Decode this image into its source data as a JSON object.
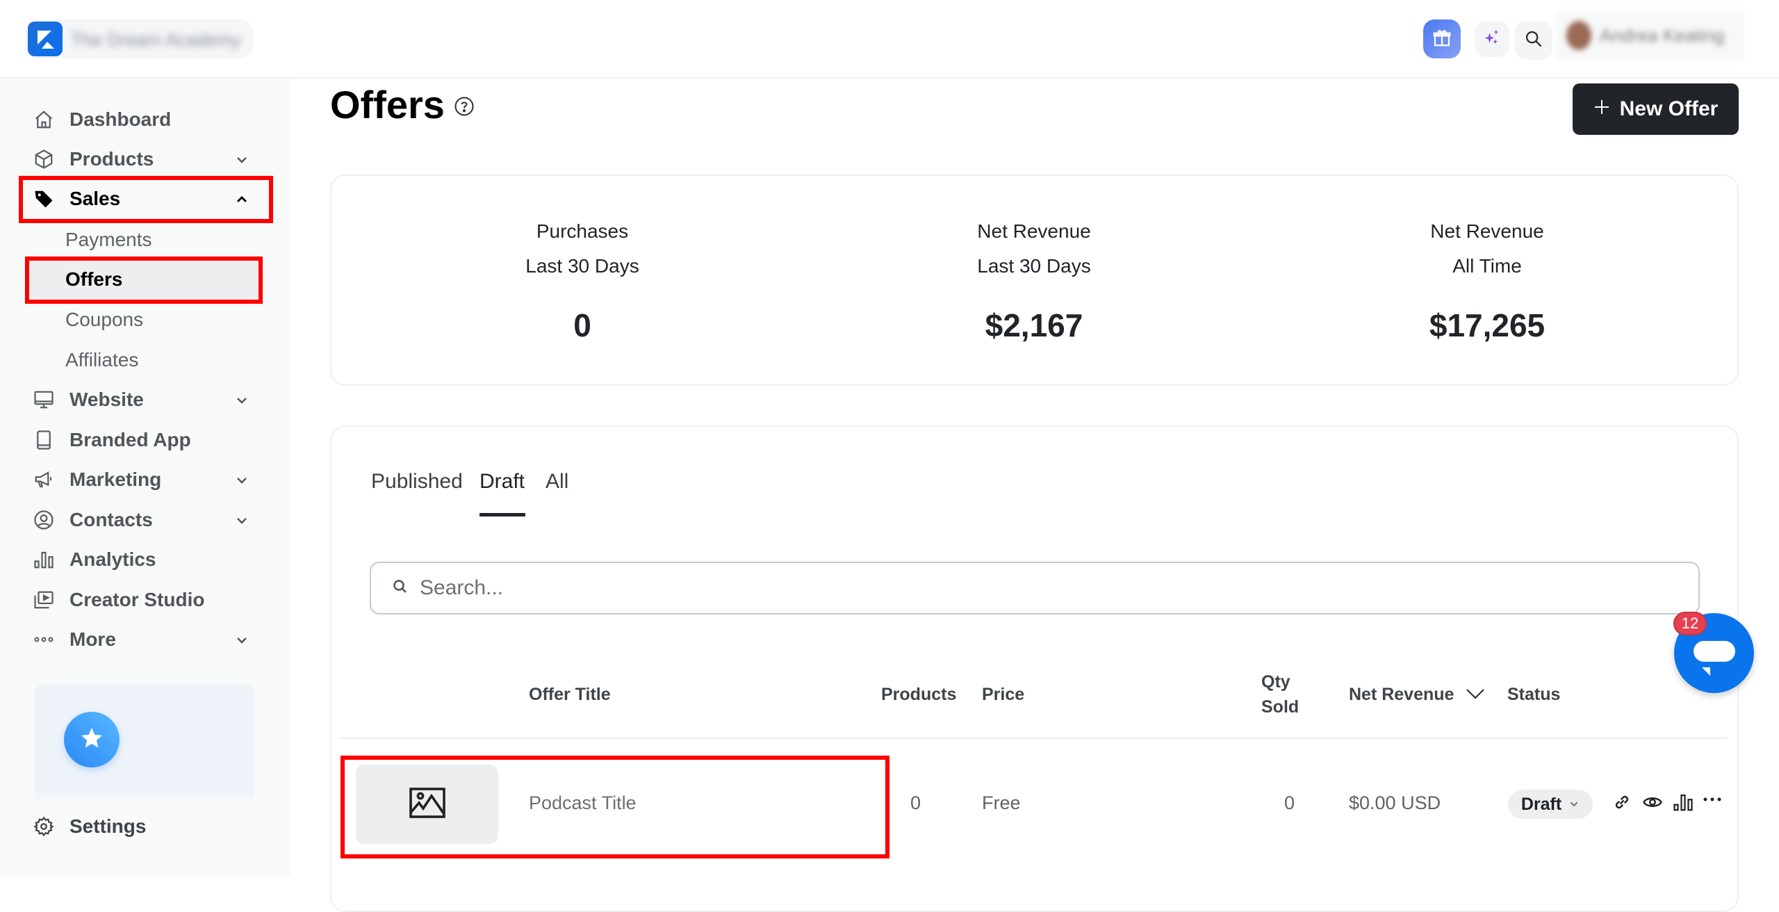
{
  "topbar": {
    "brand_name": "The Dream Academy",
    "user_name": "Andrea Keating",
    "icons": [
      "gift-icon",
      "sparkle-icon",
      "search-icon"
    ]
  },
  "sidebar": {
    "items": [
      {
        "label": "Dashboard",
        "icon": "home-icon",
        "expandable": false
      },
      {
        "label": "Products",
        "icon": "box-icon",
        "expandable": true
      },
      {
        "label": "Sales",
        "icon": "tag-icon",
        "expandable": true,
        "expanded": true,
        "active": true
      },
      {
        "label": "Website",
        "icon": "monitor-icon",
        "expandable": true
      },
      {
        "label": "Branded App",
        "icon": "tablet-icon",
        "expandable": false
      },
      {
        "label": "Marketing",
        "icon": "megaphone-icon",
        "expandable": true
      },
      {
        "label": "Contacts",
        "icon": "user-circle-icon",
        "expandable": true
      },
      {
        "label": "Analytics",
        "icon": "bar-chart-icon",
        "expandable": false
      },
      {
        "label": "Creator Studio",
        "icon": "video-library-icon",
        "expandable": false
      },
      {
        "label": "More",
        "icon": "more-dots-icon",
        "expandable": true
      }
    ],
    "sales_subitems": [
      {
        "label": "Payments",
        "active": false
      },
      {
        "label": "Offers",
        "active": true
      },
      {
        "label": "Coupons",
        "active": false
      },
      {
        "label": "Affiliates",
        "active": false
      }
    ],
    "settings_label": "Settings"
  },
  "page": {
    "title": "Offers",
    "new_offer_label": "New Offer"
  },
  "stats": [
    {
      "line1": "Purchases",
      "line2": "Last 30 Days",
      "value": "0"
    },
    {
      "line1": "Net Revenue",
      "line2": "Last 30 Days",
      "value": "$2,167"
    },
    {
      "line1": "Net Revenue",
      "line2": "All Time",
      "value": "$17,265"
    }
  ],
  "tabs": [
    {
      "label": "Published",
      "active": false
    },
    {
      "label": "Draft",
      "active": true
    },
    {
      "label": "All",
      "active": false
    }
  ],
  "search": {
    "placeholder": "Search...",
    "value": ""
  },
  "table": {
    "columns": [
      "Offer Title",
      "Products",
      "Price",
      "Qty",
      "Sold",
      "Net Revenue",
      "Status"
    ],
    "rows": [
      {
        "title": "Podcast Title",
        "products": "0",
        "price": "Free",
        "qty_sold": "0",
        "net_revenue": "$0.00 USD",
        "status": "Draft"
      }
    ]
  },
  "chat": {
    "unread_count": "12"
  },
  "colors": {
    "accent": "#0a74ec",
    "primary_button": "#212428",
    "badge": "#e5404f",
    "highlight": "#ff0000"
  }
}
